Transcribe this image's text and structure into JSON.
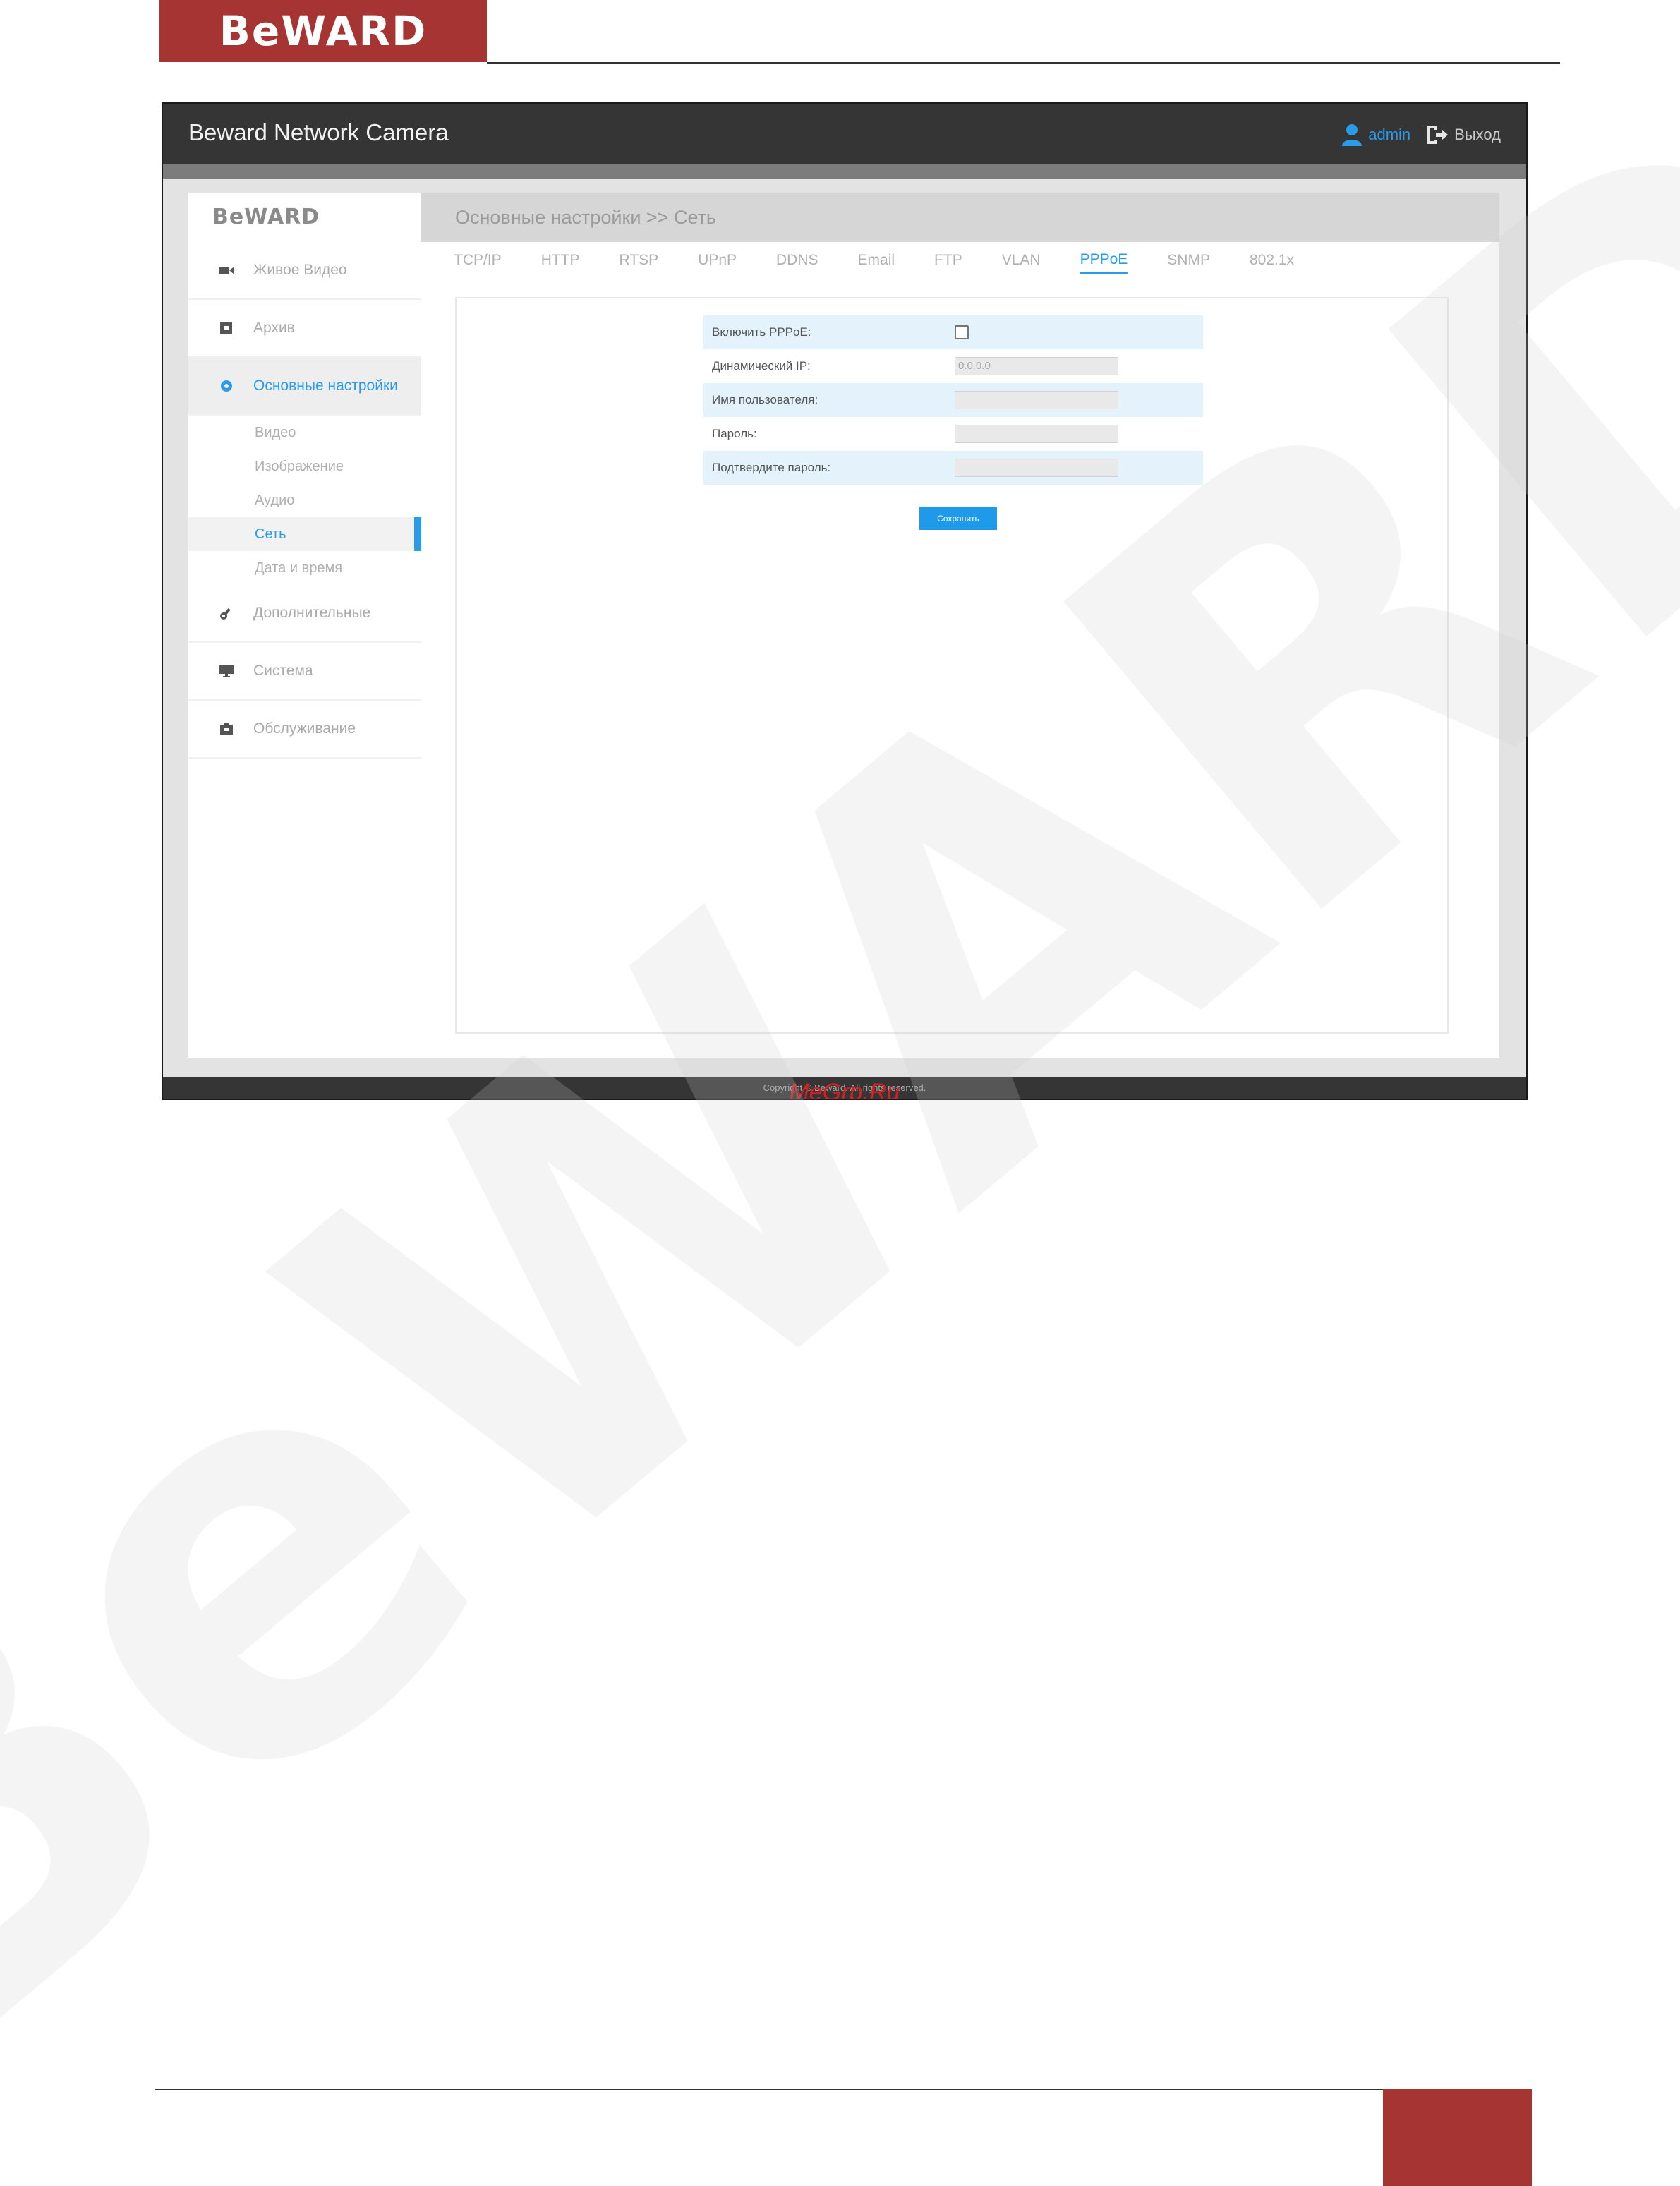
{
  "doc": {
    "logo_text": "BeWARD",
    "watermark_text": "BeWARD",
    "accent_color": "#a63433"
  },
  "app": {
    "title": "Beward Network Camera",
    "user_name": "admin",
    "logout_label": "Выход",
    "copyright": "Copyright © Beward. All rights reserved.",
    "overlay_watermark": "MeGrp.Ru"
  },
  "sidebar": {
    "logo": "BeWARD",
    "items": [
      {
        "label": "Живое Видео",
        "icon": "video-camera-icon"
      },
      {
        "label": "Архив",
        "icon": "archive-icon"
      },
      {
        "label": "Основные настройки",
        "icon": "settings-icon",
        "active": true
      },
      {
        "label": "Дополнительные",
        "icon": "wrench-icon"
      },
      {
        "label": "Система",
        "icon": "monitor-icon"
      },
      {
        "label": "Обслуживание",
        "icon": "maintenance-icon"
      }
    ],
    "subitems": [
      {
        "label": "Видео"
      },
      {
        "label": "Изображение"
      },
      {
        "label": "Аудио"
      },
      {
        "label": "Сеть",
        "active": true
      },
      {
        "label": "Дата и время"
      }
    ]
  },
  "main": {
    "breadcrumb": "Основные настройки >> Сеть",
    "tabs": [
      {
        "label": "TCP/IP"
      },
      {
        "label": "HTTP"
      },
      {
        "label": "RTSP"
      },
      {
        "label": "UPnP"
      },
      {
        "label": "DDNS"
      },
      {
        "label": "Email"
      },
      {
        "label": "FTP"
      },
      {
        "label": "VLAN"
      },
      {
        "label": "PPPoE",
        "active": true
      },
      {
        "label": "SNMP"
      },
      {
        "label": "802.1x"
      }
    ],
    "form": {
      "enable_pppoe_label": "Включить PPPoE:",
      "enable_pppoe_checked": false,
      "dynamic_ip_label": "Динамический IP:",
      "dynamic_ip_value": "0.0.0.0",
      "username_label": "Имя пользователя:",
      "username_value": "",
      "password_label": "Пароль:",
      "password_value": "",
      "confirm_password_label": "Подтвердите пароль:",
      "confirm_password_value": "",
      "save_label": "Сохранить"
    }
  },
  "colors": {
    "topbar": "#353535",
    "link_blue": "#2a9be8",
    "button_blue": "#1f9aea",
    "row_shade": "#e4f3fb"
  }
}
